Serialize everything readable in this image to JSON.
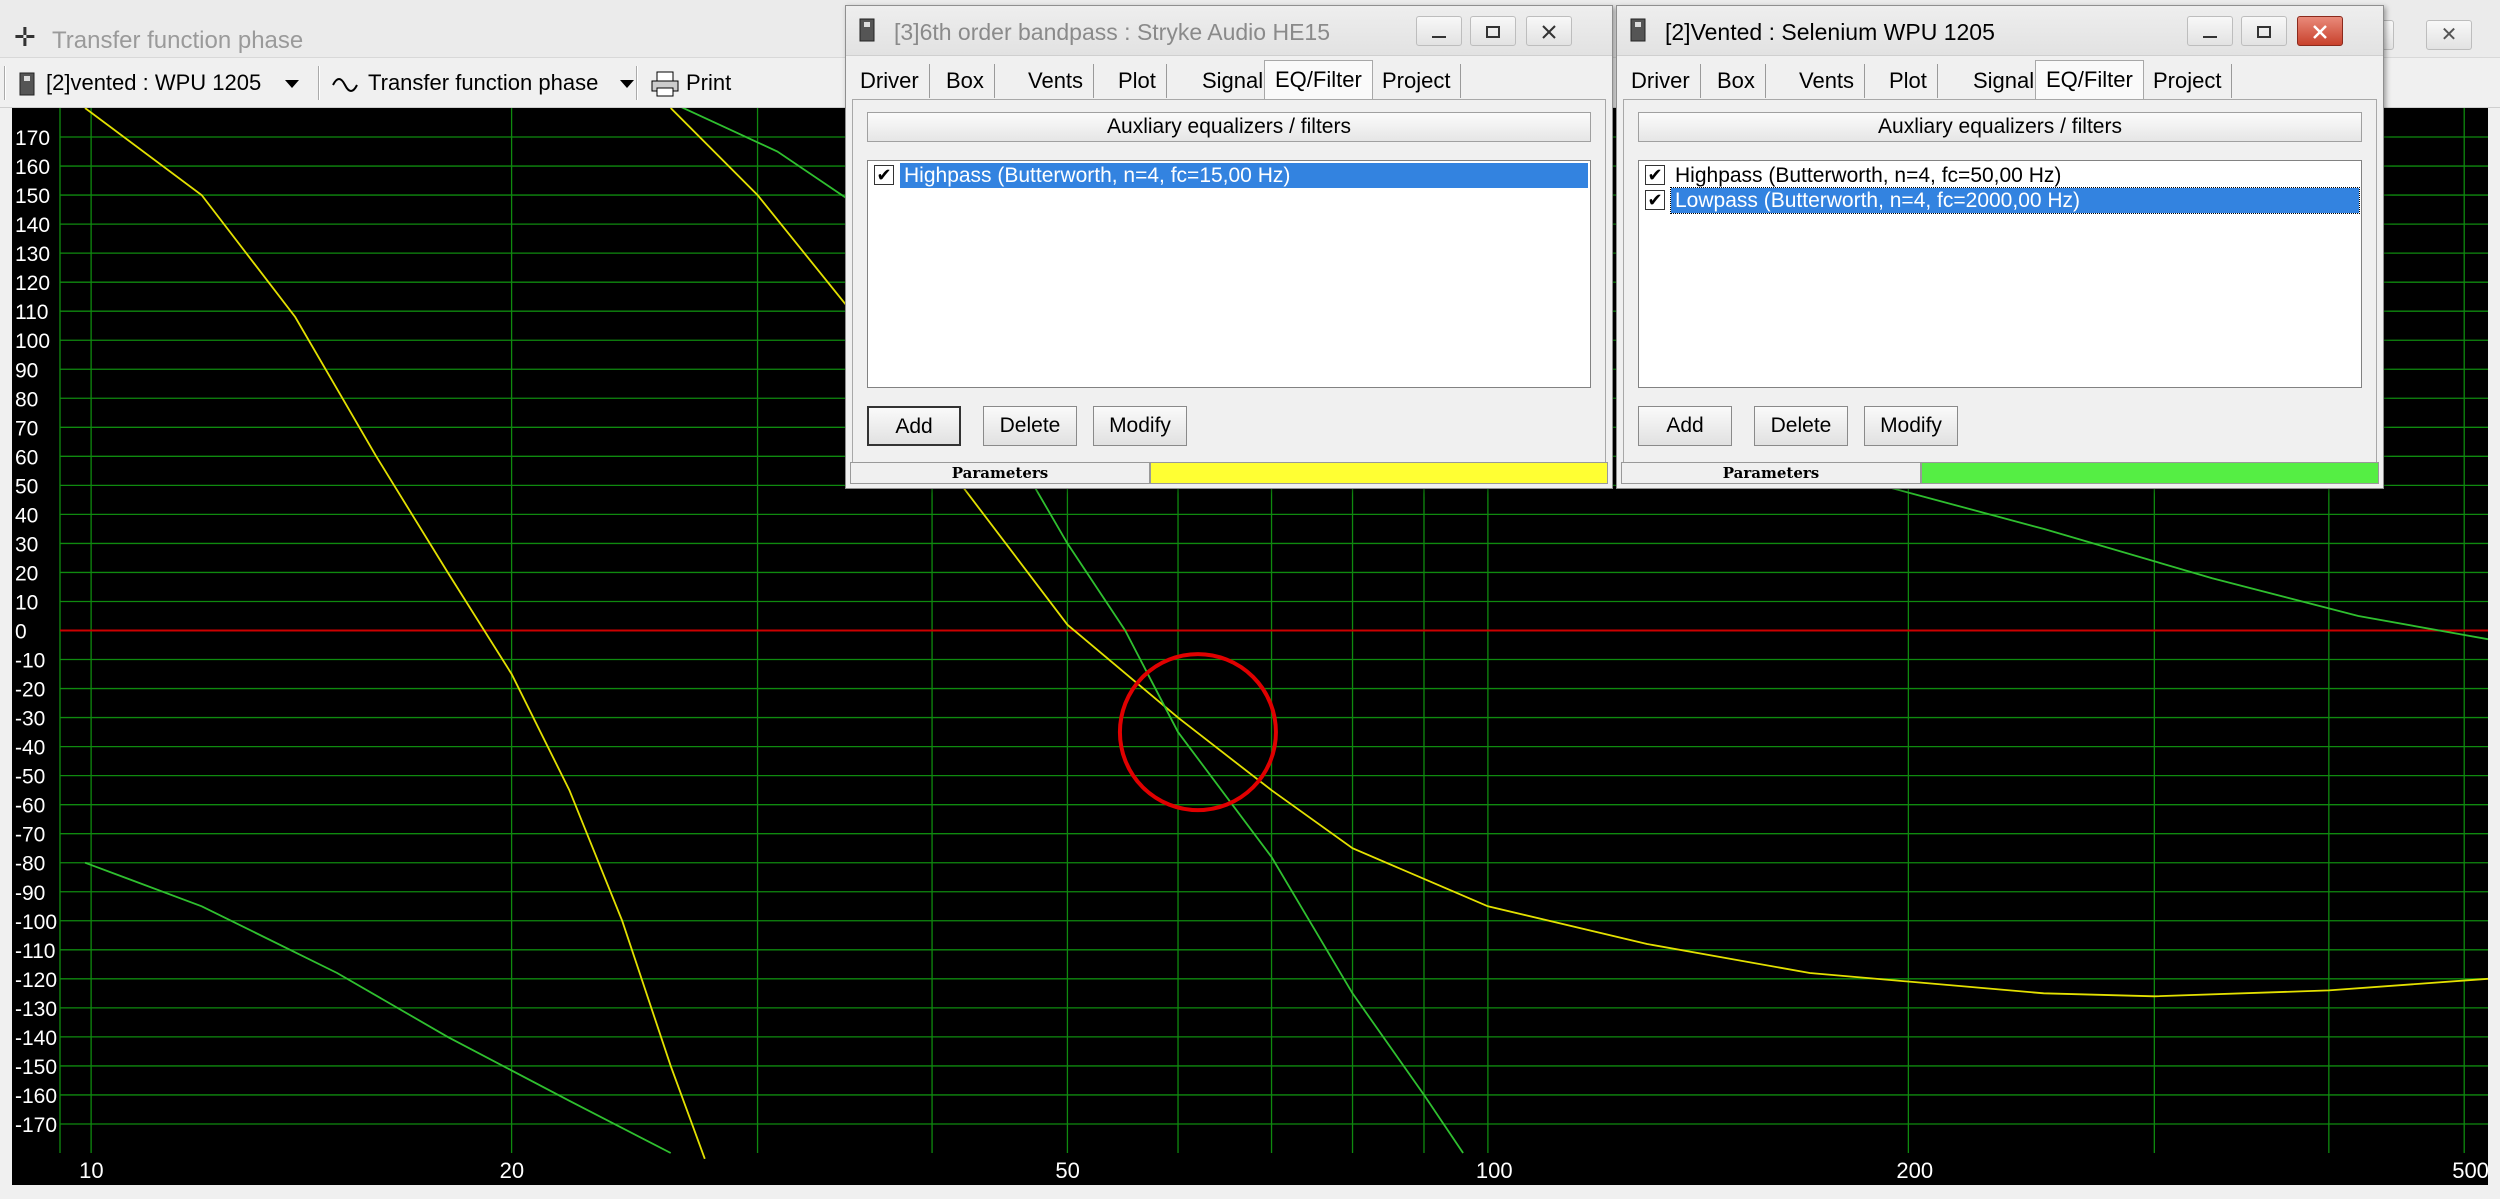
{
  "main_window": {
    "title": "Transfer function phase",
    "close_glyph": "✕",
    "restore_glyph": "❐"
  },
  "toolbar": {
    "project_select": "[2]vented : WPU 1205",
    "plot_select": "Transfer function phase",
    "print_label": "Print"
  },
  "chart_data": {
    "type": "line",
    "title": "Transfer function phase",
    "xscale": "log",
    "xlim": [
      9.5,
      520
    ],
    "ylim": [
      -180,
      180
    ],
    "grid": true,
    "ytick_labels": [
      "170",
      "160",
      "150",
      "140",
      "130",
      "120",
      "110",
      "100",
      "90",
      "80",
      "70",
      "60",
      "50",
      "40",
      "30",
      "20",
      "10",
      "0",
      "-10",
      "-20",
      "-30",
      "-40",
      "-50",
      "-60",
      "-70",
      "-80",
      "-90",
      "-100",
      "-110",
      "-120",
      "-130",
      "-140",
      "-150",
      "-160",
      "-170"
    ],
    "xtick_labels": [
      {
        "value": 10,
        "label": "10"
      },
      {
        "value": 20,
        "label": "20"
      },
      {
        "value": 50,
        "label": "50"
      },
      {
        "value": 100,
        "label": "100"
      },
      {
        "value": 200,
        "label": "200"
      },
      {
        "value": 500,
        "label": "500"
      }
    ],
    "zero_line_color": "#cc0000",
    "grid_color": "#0f8a0f",
    "series": [
      {
        "color": "#e3e000",
        "points": [
          [
            9.9,
            180
          ],
          [
            12,
            150
          ],
          [
            14,
            108
          ],
          [
            16,
            60
          ],
          [
            18,
            20
          ],
          [
            20,
            -15
          ],
          [
            22,
            -55
          ],
          [
            24,
            -100
          ],
          [
            26,
            -150
          ],
          [
            27.5,
            -182
          ]
        ]
      },
      {
        "color": "#e3e000",
        "points": [
          [
            26,
            180
          ],
          [
            30,
            150
          ],
          [
            35,
            110
          ],
          [
            42,
            50
          ],
          [
            50,
            2
          ],
          [
            60,
            -30
          ],
          [
            70,
            -55
          ],
          [
            80,
            -75
          ],
          [
            100,
            -95
          ],
          [
            130,
            -108
          ],
          [
            170,
            -118
          ],
          [
            250,
            -125
          ],
          [
            300,
            -126
          ],
          [
            400,
            -124
          ],
          [
            520,
            -120
          ]
        ]
      },
      {
        "color": "#2fbf2f",
        "points": [
          [
            26,
            182
          ],
          [
            31,
            165
          ],
          [
            37,
            140
          ],
          [
            43,
            115
          ]
        ]
      },
      {
        "color": "#2fbf2f",
        "points": [
          [
            46,
            60
          ],
          [
            50,
            30
          ],
          [
            55,
            0
          ],
          [
            60,
            -35
          ],
          [
            70,
            -78
          ],
          [
            80,
            -125
          ],
          [
            90,
            -160
          ],
          [
            96,
            -180
          ]
        ]
      },
      {
        "color": "#2fbf2f",
        "points": [
          [
            9.9,
            -80
          ],
          [
            12,
            -95
          ],
          [
            15,
            -118
          ],
          [
            18,
            -140
          ],
          [
            22,
            -162
          ],
          [
            26,
            -180
          ]
        ]
      },
      {
        "color": "#2fbf2f",
        "points": [
          [
            175,
            55
          ],
          [
            250,
            35
          ],
          [
            330,
            18
          ],
          [
            420,
            5
          ],
          [
            520,
            -3
          ]
        ]
      }
    ],
    "annotation": {
      "type": "circle",
      "color": "#e00000",
      "cx": 62,
      "cy": -35
    }
  },
  "subwindow_bandpass": {
    "title": "[3]6th order bandpass : Stryke Audio HE15",
    "tabs": [
      "Driver",
      "Box",
      "Vents",
      "Plot",
      "Signal",
      "EQ/Filter",
      "Project"
    ],
    "active_tab": "EQ/Filter",
    "header": "Auxliary equalizers / filters",
    "items": [
      {
        "label": "Highpass (Butterworth, n=4, fc=15,00 Hz)",
        "checked": "✔"
      }
    ],
    "buttons": {
      "add": "Add",
      "delete": "Delete",
      "modify": "Modify"
    },
    "status_label": "Parameters",
    "status_color": "#ffff33"
  },
  "subwindow_vented": {
    "title": "[2]Vented : Selenium WPU 1205",
    "tabs": [
      "Driver",
      "Box",
      "Vents",
      "Plot",
      "Signal",
      "EQ/Filter",
      "Project"
    ],
    "active_tab": "EQ/Filter",
    "header": "Auxliary equalizers / filters",
    "items": [
      {
        "label": "Highpass (Butterworth, n=4, fc=50,00 Hz)",
        "checked": "✔"
      },
      {
        "label": "Lowpass (Butterworth, n=4, fc=2000,00 Hz)",
        "checked": "✔"
      }
    ],
    "buttons": {
      "add": "Add",
      "delete": "Delete",
      "modify": "Modify"
    },
    "status_label": "Parameters",
    "status_color": "#55ee44"
  }
}
